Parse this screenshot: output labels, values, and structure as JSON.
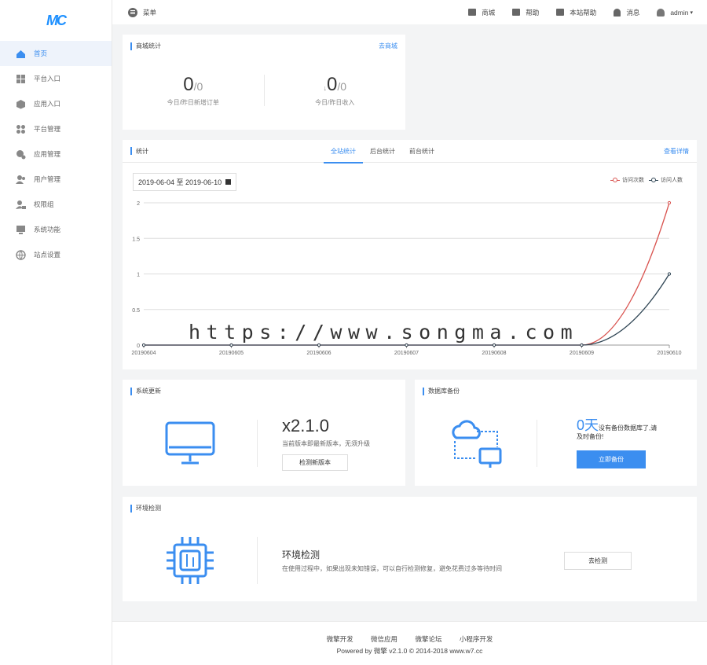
{
  "logo": "MC",
  "sidebar": {
    "items": [
      {
        "label": "首页",
        "icon": "home-icon",
        "active": true
      },
      {
        "label": "平台入口",
        "icon": "grid-icon"
      },
      {
        "label": "应用入口",
        "icon": "cube-icon"
      },
      {
        "label": "平台管理",
        "icon": "apps-icon"
      },
      {
        "label": "应用管理",
        "icon": "app-manage-icon"
      },
      {
        "label": "用户管理",
        "icon": "users-icon"
      },
      {
        "label": "权限组",
        "icon": "user-lock-icon"
      },
      {
        "label": "系统功能",
        "icon": "monitor-icon"
      },
      {
        "label": "站点设置",
        "icon": "globe-icon"
      }
    ]
  },
  "topbar": {
    "menu_label": "菜单",
    "links": [
      "商城",
      "帮助",
      "本站帮助",
      "消息"
    ],
    "user": "admin"
  },
  "mall": {
    "title": "商城统计",
    "link": "去商城",
    "orders_value": "0",
    "orders_prev": "/0",
    "orders_label": "今日/昨日新增订单",
    "income_arrow": "↓",
    "income_value": "0",
    "income_prev": "/0",
    "income_label": "今日/昨日收入"
  },
  "stats": {
    "title": "统计",
    "tabs": [
      "全站统计",
      "后台统计",
      "前台统计"
    ],
    "link": "查看详情",
    "date_range": "2019-06-04 至 2019-06-10"
  },
  "chart_data": {
    "type": "line",
    "x": [
      "20190604",
      "20190605",
      "20190606",
      "20190607",
      "20190608",
      "20190609",
      "20190610"
    ],
    "series": [
      {
        "name": "访问次数",
        "values": [
          0,
          0,
          0,
          0,
          0,
          0,
          2
        ],
        "color": "#d9534f"
      },
      {
        "name": "访问人数",
        "values": [
          0,
          0,
          0,
          0,
          0,
          0,
          1
        ],
        "color": "#2f4554"
      }
    ],
    "ylim": [
      0,
      2
    ],
    "yticks": [
      "0",
      "0.5",
      "1",
      "1.5",
      "2"
    ],
    "grid": true,
    "legend_position": "top-right"
  },
  "watermark": "https://www.songma.com",
  "update": {
    "title": "系统更新",
    "version": "x2.1.0",
    "desc": "当前版本即最新版本，无须升级",
    "button": "检测新版本"
  },
  "backup": {
    "title": "数据库备份",
    "days": "0天",
    "desc": "没有备份数据库了,请及时备份!",
    "button": "立即备份"
  },
  "env": {
    "title": "环境检测",
    "heading": "环境检测",
    "desc": "在使用过程中，如果出现未知错误，可以自行检测修复，避免花费过多等待时间",
    "button": "去检测"
  },
  "footer": {
    "links": [
      "微擎开发",
      "微信应用",
      "微擎论坛",
      "小程序开发"
    ],
    "copyright": "Powered by 微擎 v2.1.0 © 2014-2018 www.w7.cc"
  },
  "colors": {
    "accent": "#3b8ef0",
    "red": "#d9534f",
    "navy": "#2f4554"
  }
}
